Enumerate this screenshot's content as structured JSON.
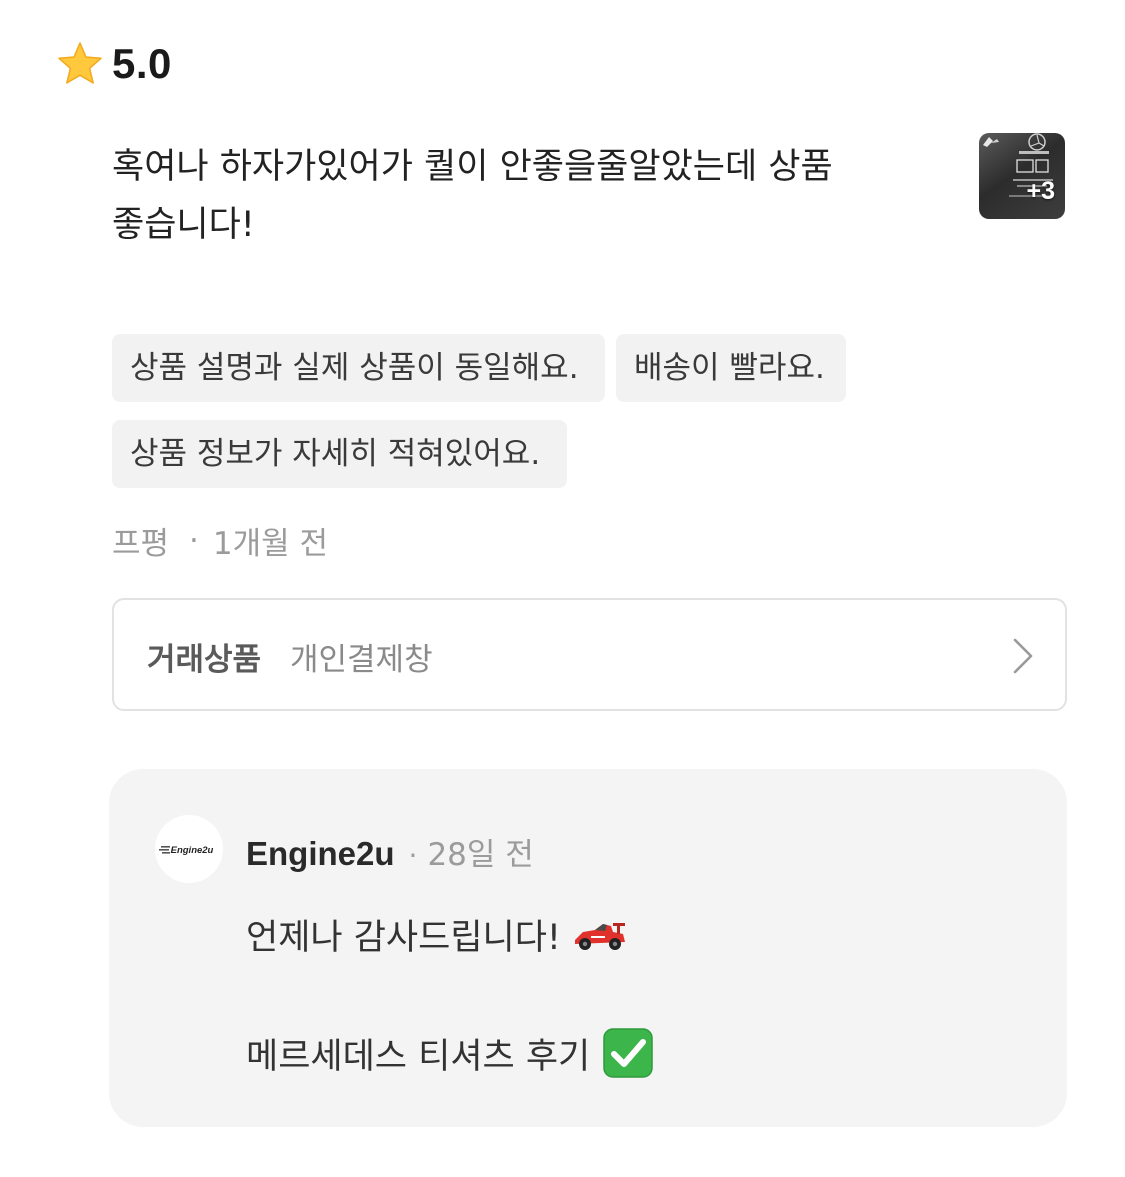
{
  "review": {
    "rating": "5.0",
    "text": "혹여나 하자가있어가 퀄이 안좋을줄알았는데 상품 좋습니다!",
    "photo_more": "+3",
    "tags": [
      "상품 설명과 실제 상품이 동일해요.",
      "배송이 빨라요.",
      "상품 정보가 자세히 적혀있어요."
    ],
    "author": "프평",
    "meta_separator": "·",
    "time": "1개월 전"
  },
  "trade": {
    "label": "거래상품",
    "value": "개인결제창"
  },
  "reply": {
    "seller_name": "Engine2u",
    "separator": "·",
    "time": "28일 전",
    "avatar_logo_text": "Engine2u",
    "line1": "언제나 감사드립니다!",
    "line2": "메르세데스 티셔츠 후기",
    "line1_emoji": "racing-car-icon",
    "line2_emoji": "check-mark-button-icon"
  },
  "colors": {
    "star": "#FFC83D",
    "tag_bg": "#F2F2F2",
    "reply_bg": "#F4F4F4",
    "check_green": "#3CB54A",
    "muted_text": "#9B9B9B"
  }
}
